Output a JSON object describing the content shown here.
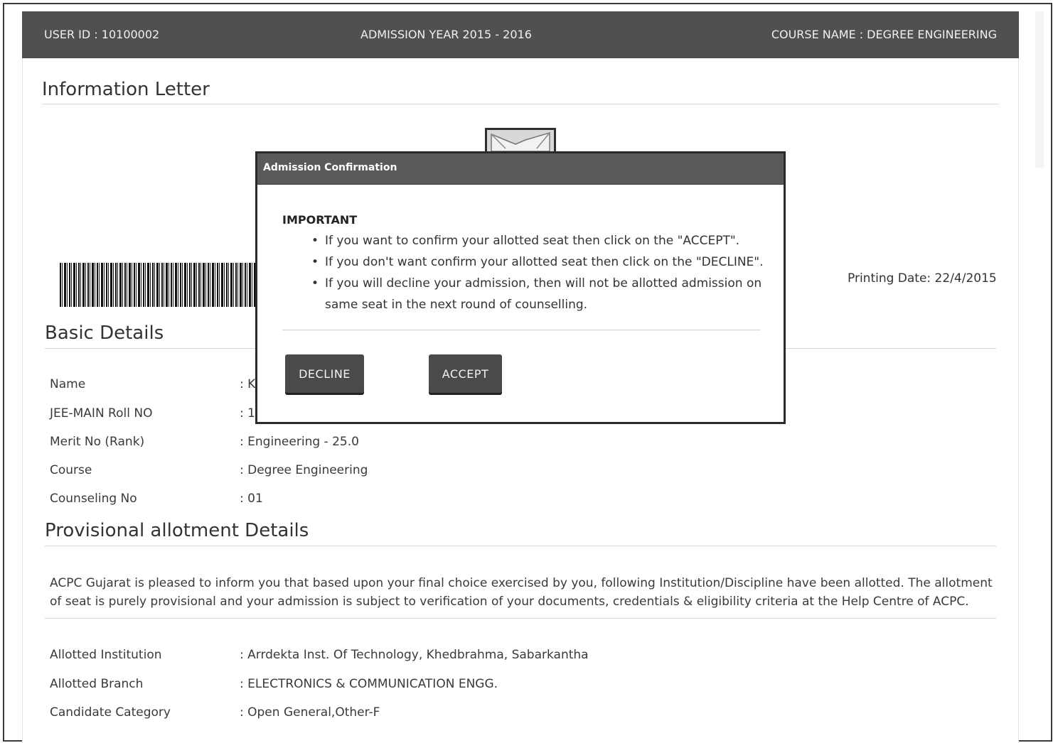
{
  "header": {
    "user_id": "USER ID : 10100002",
    "admission_year": "ADMISSION YEAR 2015 - 2016",
    "course_name": "COURSE NAME : DEGREE ENGINEERING"
  },
  "info_letter": {
    "title": "Information Letter"
  },
  "printing_date": "Printing Date: 22/4/2015",
  "basic_details": {
    "title": "Basic Details",
    "rows": [
      {
        "label": "Name",
        "value": ": K"
      },
      {
        "label": "JEE-MAIN Roll NO",
        "value": ": 1"
      },
      {
        "label": "Merit No (Rank)",
        "value": ": Engineering - 25.0"
      },
      {
        "label": "Course",
        "value": ": Degree Engineering"
      },
      {
        "label": "Counseling No",
        "value": ": 01"
      }
    ]
  },
  "provisional": {
    "title": "Provisional allotment Details",
    "paragraph": "ACPC Gujarat is pleased to inform you that based upon your final choice exercised by you, following Institution/Discipline have been allotted. The allotment of seat is purely provisional and your admission is subject to verification of your documents, credentials & eligibility criteria at the Help Centre of ACPC.",
    "rows": [
      {
        "label": "Allotted Institution",
        "value": ": Arrdekta Inst. Of Technology, Khedbrahma, Sabarkantha"
      },
      {
        "label": "Allotted Branch",
        "value": ": ELECTRONICS & COMMUNICATION ENGG."
      },
      {
        "label": "Candidate Category",
        "value": ": Open General,Other-F"
      }
    ]
  },
  "modal": {
    "title": "Admission Confirmation",
    "important": "IMPORTANT",
    "bullets": [
      "If you want to confirm your allotted seat then click on the \"ACCEPT\".",
      "If you don't want confirm your allotted seat then click on the \"DECLINE\".",
      "If you will decline your admission, then will not be allotted admission on same seat in the next round of counselling."
    ],
    "decline_label": "DECLINE",
    "accept_label": "ACCEPT"
  },
  "icons": {
    "bullet": "•",
    "logo": "institute-logo-icon",
    "barcode": "barcode-image"
  }
}
